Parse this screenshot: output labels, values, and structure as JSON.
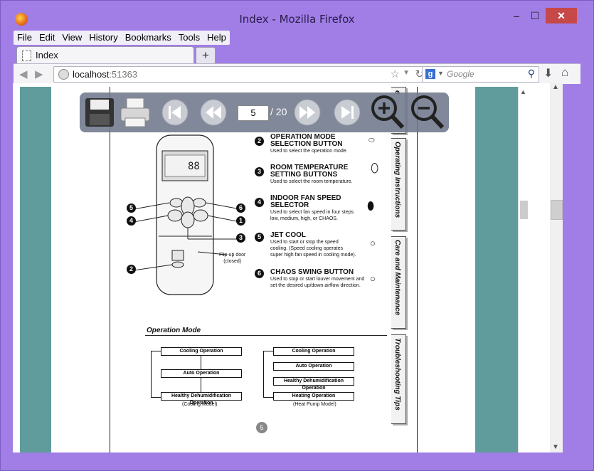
{
  "window": {
    "title": "Index - Mozilla Firefox",
    "min_glyph": "–",
    "max_glyph": "☐",
    "close_glyph": "✕"
  },
  "menu": [
    "File",
    "Edit",
    "View",
    "History",
    "Bookmarks",
    "Tools",
    "Help"
  ],
  "tab": {
    "label": "Index",
    "new_tab": "+"
  },
  "nav": {
    "url_host": "localhost",
    "url_port": ":51363",
    "search_placeholder": "Google",
    "search_engine_icon": "google-icon"
  },
  "viewer": {
    "current_page": "5",
    "total_pages": "/ 20",
    "tool_icons": [
      "save-icon",
      "print-icon",
      "first-page-icon",
      "prev-page-icon",
      "next-page-icon",
      "last-page-icon",
      "zoom-in-icon",
      "zoom-out-icon"
    ]
  },
  "manual": {
    "items": [
      {
        "n": "2",
        "title1": "OPERATION MODE",
        "title2": "SELECTION BUTTON",
        "desc": [
          "Used to select the operation mode."
        ]
      },
      {
        "n": "3",
        "title1": "ROOM TEMPERATURE",
        "title2": "SETTING BUTTONS",
        "desc": [
          "Used to select the room temperature."
        ]
      },
      {
        "n": "4",
        "title1": "INDOOR FAN SPEED",
        "title2": "SELECTOR",
        "desc": [
          "Used to select fan speed in four steps",
          "low, medium, high, or CHAOS."
        ]
      },
      {
        "n": "5",
        "title1": "JET COOL",
        "title2": "",
        "desc": [
          "Used to start or stop the speed",
          "cooling. (Speed cooling operates",
          "super high fan speed in cooling mode)."
        ]
      },
      {
        "n": "6",
        "title1": "CHAOS SWING BUTTON",
        "title2": "",
        "desc": [
          "Used to stop or start louver movement and",
          "set the desired up/down airflow direction."
        ]
      }
    ],
    "flip_label": [
      "Flip-up door",
      "(closed)"
    ],
    "remote_callouts": [
      "5",
      "6",
      "4",
      "1",
      "3",
      "2"
    ],
    "section_title": "Operation Mode",
    "cooling_flow": [
      "Cooling Operation",
      "Auto Operation",
      "Healthy Dehumidification Operation"
    ],
    "cooling_caption": "(Cooling Model)",
    "heat_flow": [
      "Cooling Operation",
      "Auto Operation",
      "Healthy Dehumidification Operation",
      "Heating Operation"
    ],
    "heat_caption": "(Heat Pump Model)",
    "page_number": "5",
    "side_tabs": [
      "Operating Instructions",
      "Care and Maintenance",
      "Troubleshooting Tips"
    ],
    "top_tab_fragment": "e"
  }
}
